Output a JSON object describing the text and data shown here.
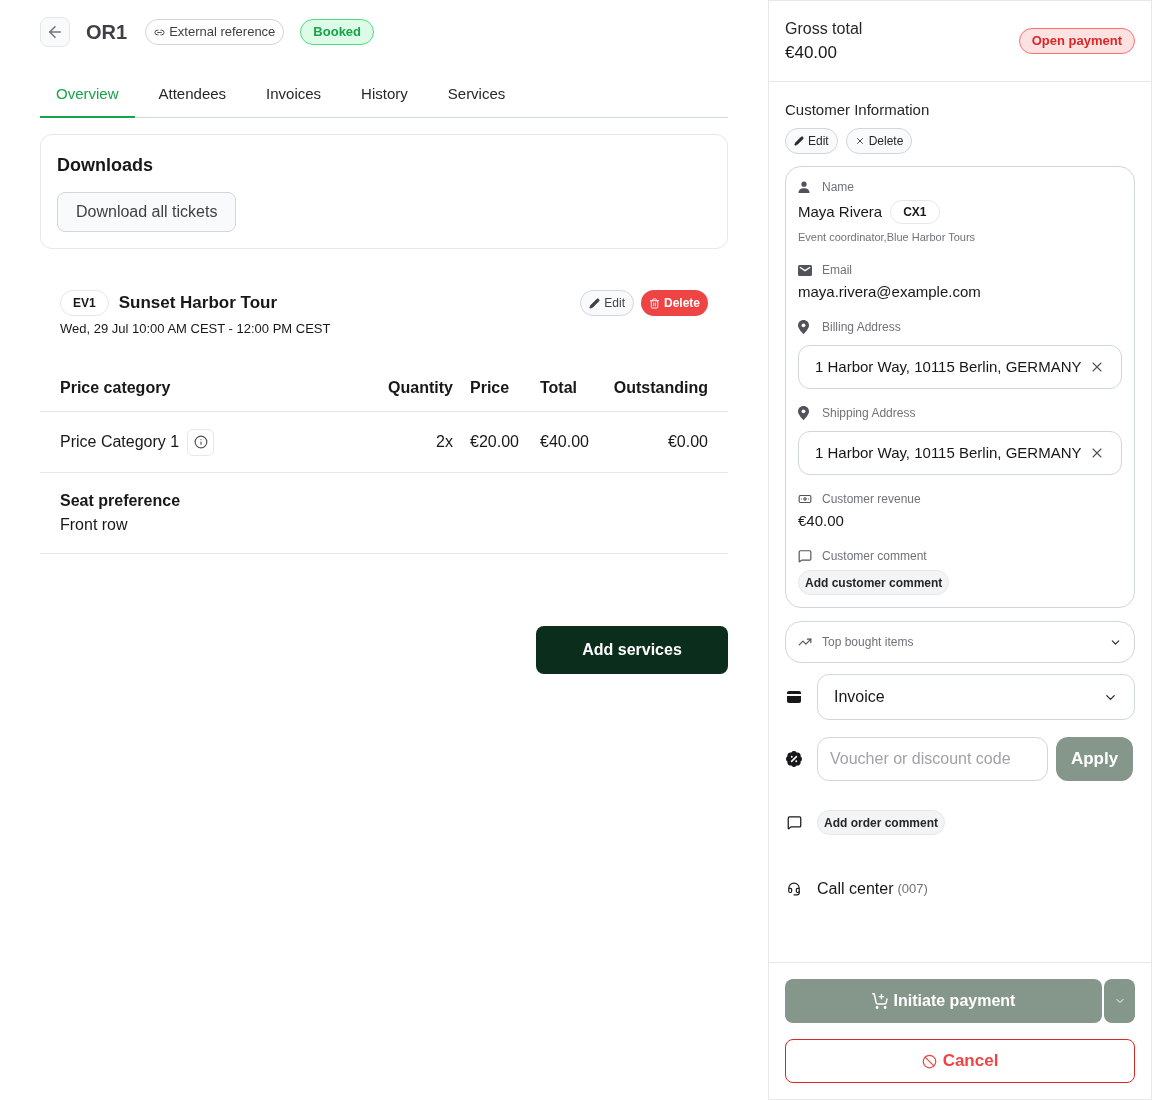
{
  "header": {
    "order_id": "OR1",
    "external_reference": "External reference",
    "status": {
      "label": "Booked",
      "kind": "success"
    }
  },
  "tabs": [
    {
      "label": "Overview",
      "selected": true
    },
    {
      "label": "Attendees",
      "selected": false
    },
    {
      "label": "Invoices",
      "selected": false
    },
    {
      "label": "History",
      "selected": false
    },
    {
      "label": "Services",
      "selected": false
    }
  ],
  "downloads": {
    "title": "Downloads",
    "button": "Download all tickets"
  },
  "event": {
    "code": "EV1",
    "title": "Sunset Harbor Tour",
    "date": "Wed, 29 Jul 10:00 AM CEST - 12:00 PM CEST",
    "edit_button": "Edit",
    "delete_button": "Delete"
  },
  "table": {
    "columns": [
      "Price category",
      "Quantity",
      "Price",
      "Total",
      "Outstanding"
    ],
    "rows": [
      {
        "category": "Price Category 1",
        "quantity": "2x",
        "price": "€20.00",
        "total": "€40.00",
        "outstanding": "€0.00"
      }
    ]
  },
  "seat_preference": {
    "label": "Seat preference",
    "value": "Front row"
  },
  "add_services_button": "Add services",
  "summary": {
    "label": "Gross total",
    "amount": "€40.00",
    "payment_status": {
      "label": "Open payment",
      "kind": "danger"
    }
  },
  "customer": {
    "title": "Customer Information",
    "edit_button": "Edit",
    "delete_button": "Delete",
    "fields": [
      {
        "kind": "name",
        "label": "Name",
        "value": "Maya Rivera",
        "badge": "CX1",
        "detail": "Event coordinator,Blue Harbor Tours"
      },
      {
        "kind": "email",
        "label": "Email",
        "value": "maya.rivera@example.com"
      },
      {
        "kind": "address",
        "label": "Billing Address",
        "value": "1 Harbor Way, 10115 Berlin, GERMANY"
      },
      {
        "kind": "address",
        "label": "Shipping Address",
        "value": "1 Harbor Way, 10115 Berlin, GERMANY"
      },
      {
        "kind": "revenue",
        "label": "Customer revenue",
        "value": "€40.00"
      },
      {
        "kind": "comment",
        "label": "Customer comment",
        "button": "Add customer comment"
      }
    ]
  },
  "top_bought_items": {
    "label": "Top bought items",
    "expanded": false
  },
  "payment_method": {
    "value": "Invoice"
  },
  "voucher": {
    "placeholder": "Voucher or discount code",
    "button": "Apply"
  },
  "order_comment": {
    "button": "Add order comment"
  },
  "call_center": {
    "label": "Call center",
    "count": "(007)"
  },
  "actions": {
    "primary": "Initiate payment",
    "cancel": "Cancel"
  }
}
